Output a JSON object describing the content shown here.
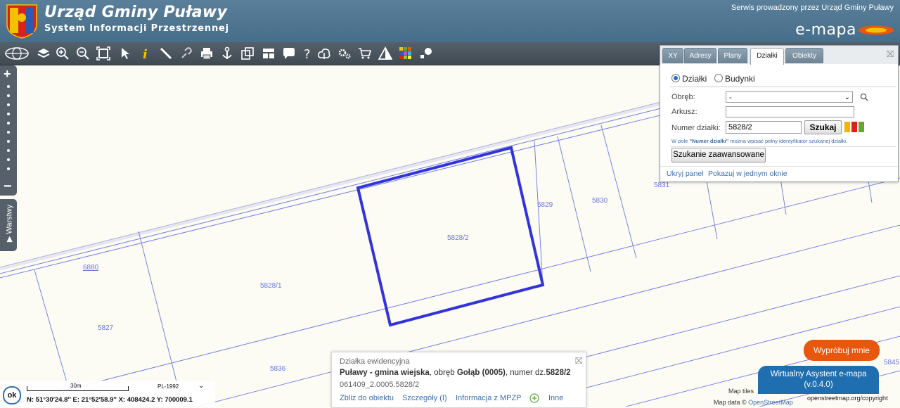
{
  "header": {
    "title": "Urząd Gminy Puławy",
    "subtitle": "System Informacji Przestrzennej",
    "serwis": "Serwis prowadzony przez Urząd Gminy Puławy",
    "product": "e-mapa"
  },
  "toolbar": {
    "icons": [
      "globe-icon",
      "layers-icon",
      "zoom-in-icon",
      "zoom-out-icon",
      "zoom-extent-icon",
      "pointer-icon",
      "info-icon",
      "measure-icon",
      "link-icon",
      "print-icon",
      "anchor-icon",
      "export-icon",
      "layout-icon",
      "comment-icon",
      "help-icon",
      "bookmark-icon",
      "settings-icon",
      "cart-icon",
      "warning-icon",
      "palette-icon",
      "share-icon"
    ]
  },
  "sidebar": {
    "zoom_in": "+",
    "zoom_out": "−",
    "layers_label": "▶ Warstwy"
  },
  "search_panel": {
    "tabs": [
      {
        "label": "XY",
        "active": false
      },
      {
        "label": "Adresy",
        "active": false
      },
      {
        "label": "Plany",
        "active": false
      },
      {
        "label": "Działki",
        "active": true
      },
      {
        "label": "Obiekty",
        "active": false
      }
    ],
    "radio_dzialki": "Działki",
    "radio_budynki": "Budynki",
    "obreb_label": "Obręb:",
    "obreb_value": "-",
    "arkusz_label": "Arkusz:",
    "arkusz_value": "",
    "numer_label": "Numer działki:",
    "numer_value": "5828/2",
    "search_button": "Szukaj",
    "hint_prefix": "W pole ",
    "hint_bold": "\"Numer działki\"",
    "hint_suffix": " można wpisać pełny identyfikator szukanej działki.",
    "advanced_button": "Szukanie zaawansowane",
    "hide_panel": "Ukryj panel",
    "show_one_window": "Pokazuj w jednym oknie",
    "colors": [
      "#f5b400",
      "#d8231a",
      "#6aa532"
    ]
  },
  "map": {
    "parcel_labels": [
      "5828/2",
      "5829",
      "5830",
      "5831",
      "5828/1",
      "6880",
      "5827",
      "5836",
      "5845"
    ]
  },
  "info_popup": {
    "title": "Działka ewidencyjna",
    "place": "Puławy - gmina wiejska",
    "obreb_text": ", obręb ",
    "obreb_name": "Gołąb (0005)",
    "numer_text": ", numer dz.",
    "numer_value": "5828/2",
    "identifier": "061409_2.0005.5828/2",
    "links": [
      "Zbliż do obiektu",
      "Szczegóły (I)",
      "Informacja z MPZP",
      "Inne"
    ]
  },
  "status_bar": {
    "ok": "ok",
    "scale": "30m",
    "crs": "PL-1992",
    "coords": "N: 51°30′24.8″  E: 21°52′58.9″  X: 408424.2   Y: 700009.1"
  },
  "assistant": {
    "try_label": "Wypróbuj mnie",
    "name": "Wirtualny Asystent e-mapa",
    "version": "(v.0.4.0)"
  },
  "attribution": {
    "tiles": "Map tiles",
    "data_prefix": "Map data © ",
    "data_link": "OpenStreetMap",
    "copyright": "openstreetmap.org/copyright"
  }
}
